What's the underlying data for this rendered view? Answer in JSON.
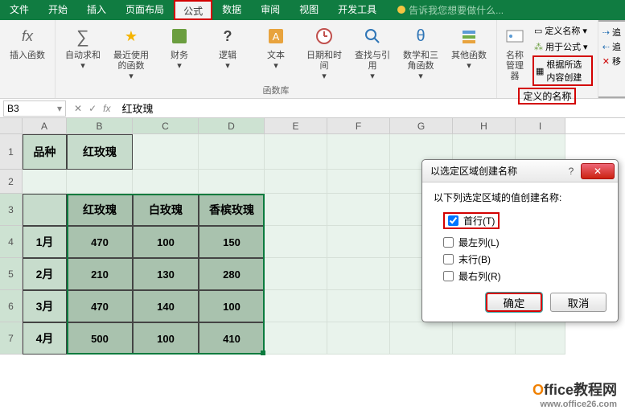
{
  "tabs": {
    "file": "文件",
    "home": "开始",
    "insert": "插入",
    "layout": "页面布局",
    "formula": "公式",
    "data": "数据",
    "review": "审阅",
    "view": "视图",
    "dev": "开发工具",
    "tell": "告诉我您想要做什么..."
  },
  "ribbon": {
    "insertfn": "插入函数",
    "autosum": "自动求和",
    "recent": "最近使用的函数",
    "financial": "财务",
    "logical": "逻辑",
    "text": "文本",
    "datetime": "日期和时间",
    "lookup": "查找与引用",
    "math": "数学和三角函数",
    "other": "其他函数",
    "lib_label": "函数库",
    "namemgr": "名称管理器",
    "defname": "定义名称",
    "useinf": "用于公式",
    "fromsel": "根据所选内容创建",
    "defnames_label": "定义的名称",
    "trace1": "追",
    "trace2": "追",
    "trace3": "移"
  },
  "namebox": "B3",
  "formula": "红玫瑰",
  "cols": [
    "A",
    "B",
    "C",
    "D",
    "E",
    "F",
    "G",
    "H",
    "I"
  ],
  "rows": [
    "1",
    "2",
    "3",
    "4",
    "5",
    "6",
    "7"
  ],
  "table": {
    "h1": "品种",
    "h2": "红玫瑰",
    "c1": "红玫瑰",
    "c2": "白玫瑰",
    "c3": "香槟玫瑰",
    "r": [
      {
        "m": "1月",
        "a": "470",
        "b": "100",
        "c": "150"
      },
      {
        "m": "2月",
        "a": "210",
        "b": "130",
        "c": "280"
      },
      {
        "m": "3月",
        "a": "470",
        "b": "140",
        "c": "100"
      },
      {
        "m": "4月",
        "a": "500",
        "b": "100",
        "c": "410"
      }
    ]
  },
  "dialog": {
    "title": "以选定区域创建名称",
    "subtitle": "以下列选定区域的值创建名称:",
    "top": "首行(T)",
    "left": "最左列(L)",
    "bottom": "末行(B)",
    "right": "最右列(R)",
    "ok": "确定",
    "cancel": "取消"
  },
  "watermark": {
    "brand1": "O",
    "brand2": "ffice教程网",
    "url": "www.office26.com"
  }
}
